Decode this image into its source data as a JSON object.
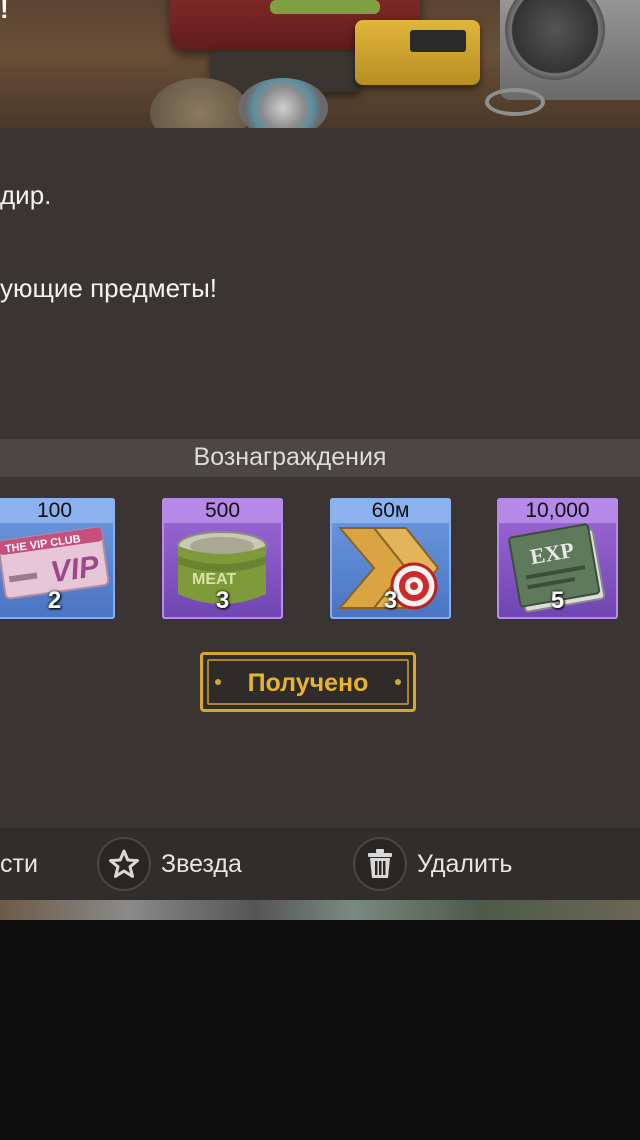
{
  "banner": {
    "fragment_text": "!"
  },
  "message": {
    "line1": "дир.",
    "line2": "ующие предметы!"
  },
  "rewards": {
    "title": "Вознаграждения",
    "items": [
      {
        "name": "vip-card",
        "amount": "100",
        "count": "2",
        "rarity": "blue"
      },
      {
        "name": "meat-can",
        "amount": "500",
        "count": "3",
        "rarity": "purple"
      },
      {
        "name": "speedup",
        "amount": "60м",
        "count": "3",
        "rarity": "blue"
      },
      {
        "name": "exp-book",
        "amount": "10,000",
        "count": "5",
        "rarity": "purple"
      }
    ],
    "vip_card_text": "THE VIP CLUB",
    "vip_card_big": "VIP",
    "meat_label": "MEAT",
    "exp_label": "EXP"
  },
  "claim_button": {
    "label": "Получено"
  },
  "actions": {
    "details_label": "сти",
    "star_label": "Звезда",
    "delete_label": "Удалить"
  },
  "colors": {
    "panel": "#3a3533",
    "gold": "#e7b52d",
    "blue_rarity": "#4a74c2",
    "purple_rarity": "#6f45b2"
  }
}
